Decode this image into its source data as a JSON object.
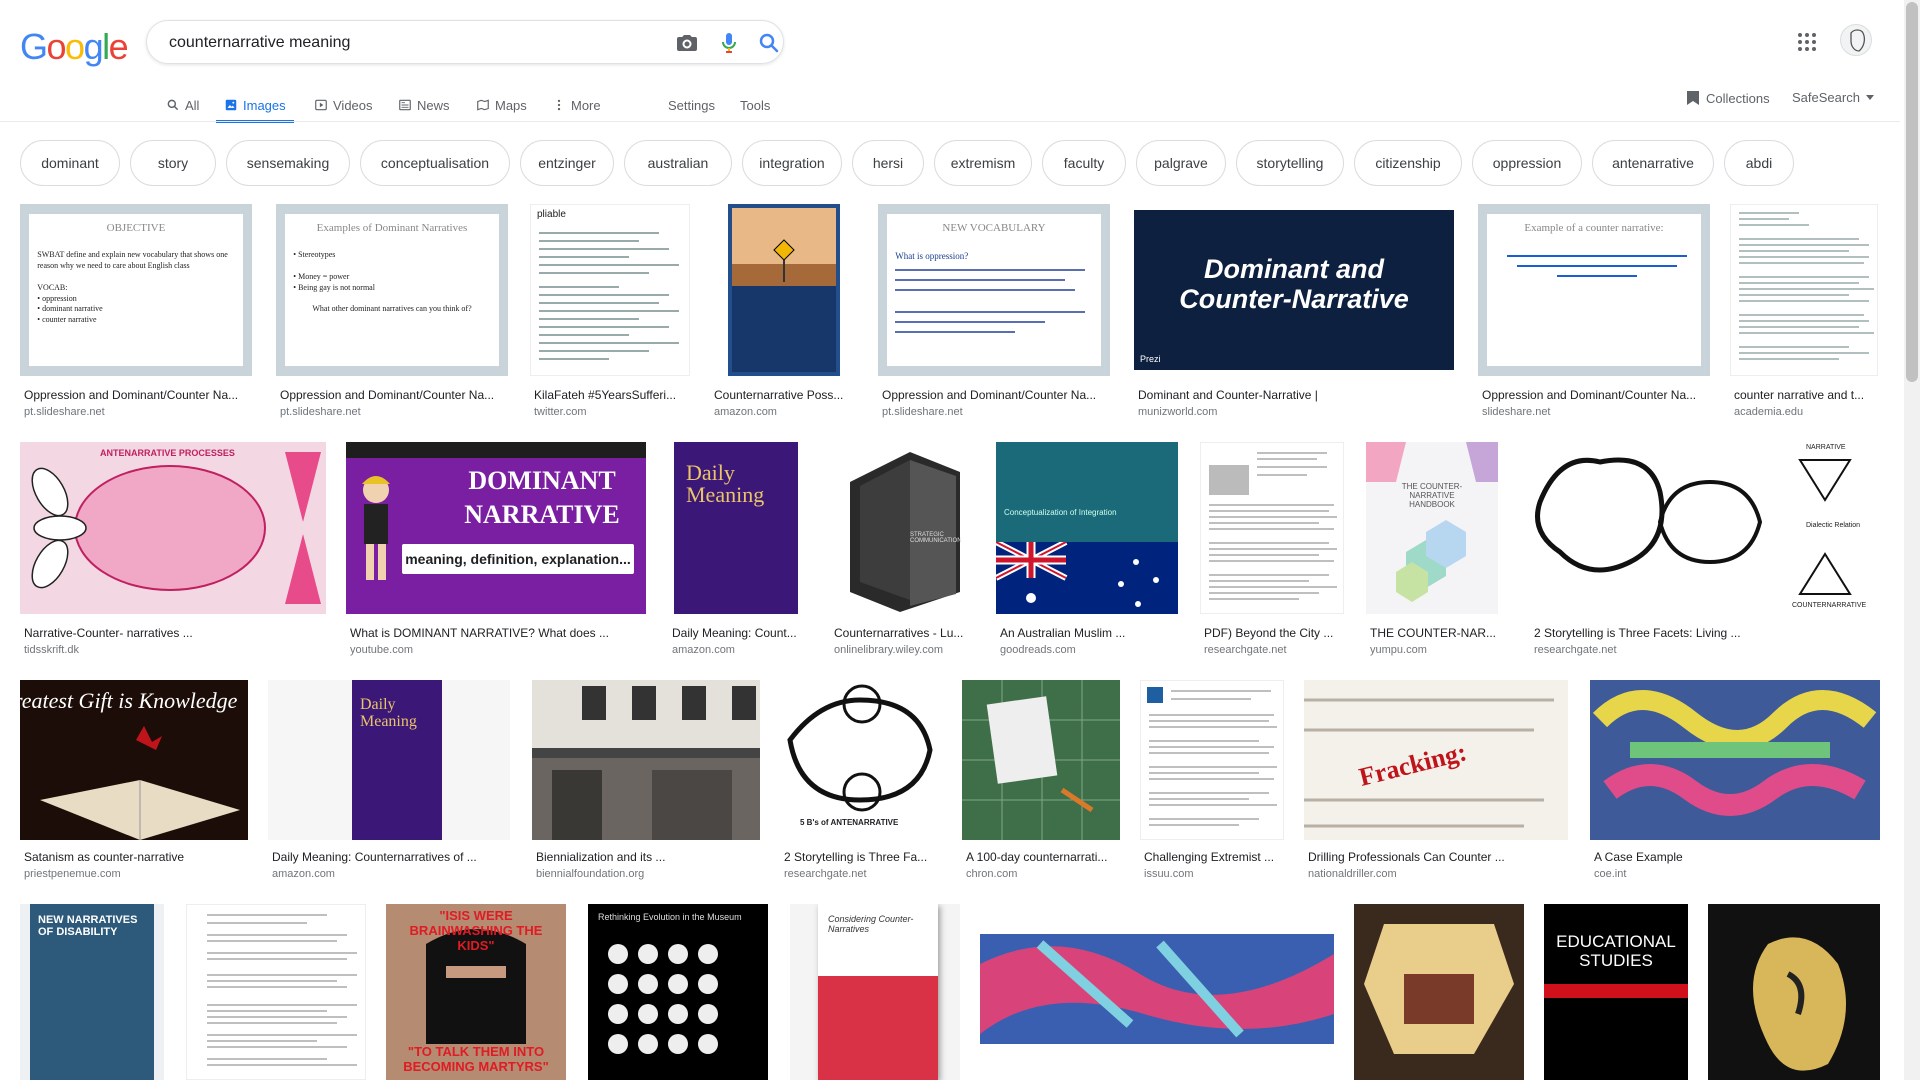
{
  "logo": [
    "G",
    "o",
    "o",
    "g",
    "l",
    "e"
  ],
  "search": {
    "query": "counternarrative meaning"
  },
  "tabs": [
    {
      "label": "All"
    },
    {
      "label": "Images"
    },
    {
      "label": "Videos"
    },
    {
      "label": "News"
    },
    {
      "label": "Maps"
    },
    {
      "label": "More"
    }
  ],
  "tools": {
    "settings": "Settings",
    "tools": "Tools"
  },
  "right": {
    "collections": "Collections",
    "safesearch": "SafeSearch"
  },
  "chips": [
    "dominant",
    "story",
    "sensemaking",
    "conceptualisation",
    "entzinger",
    "australian",
    "integration",
    "hersi",
    "extremism",
    "faculty",
    "palgrave",
    "storytelling",
    "citizenship",
    "oppression",
    "antenarrative",
    "abdi"
  ],
  "thumb_text": {
    "t1_title": "OBJECTIVE",
    "t1_body": "SWBAT define and explain new vocabulary that shows one reason why we need to care about English class",
    "t1_vocab": "VOCAB:",
    "t1_v1": "oppression",
    "t1_v2": "dominant narrative",
    "t1_v3": "counter narrative",
    "t2_title": "Examples of Dominant Narratives",
    "t2_b1": "Stereotypes",
    "t2_b2": "Money = power",
    "t2_b3": "Being gay is not normal",
    "t2_q": "What other dominant narratives can you think of?",
    "t3_word": "pliable",
    "t5_title": "NEW VOCABULARY",
    "t5_body": "What is oppression?",
    "t6_text": "Dominant and Counter-Narrative",
    "t6_brand": "Prezi",
    "t7_title": "Example of a counter narrative:",
    "r2_1": "ANTENARRATIVE PROCESSES",
    "r2_2a": "DOMINANT",
    "r2_2b": "NARRATIVE",
    "r2_2c": "meaning, definition, explanation...",
    "r2_3a": "Daily",
    "r2_3b": "Meaning",
    "r2_4": "STRATEGIC COMMUNICATION",
    "r2_5": "Conceptualization of Integration",
    "r2_7": "THE COUNTER-NARRATIVE HANDBOOK",
    "r2_8a": "NARRATIVE",
    "r2_8b": "COUNTERNARRATIVE",
    "r2_8c": "Dialectic Relation",
    "r3_1": "reatest Gift is Knowledge",
    "r3_4": "5 B's of ANTENARRATIVE",
    "r3_7": "Fracking:",
    "r4_1a": "NEW NARRATIVES",
    "r4_1b": "OF DISABILITY",
    "r4_3a": "\"ISIS WERE BRAINWASHING THE KIDS\"",
    "r4_3b": "\"TO TALK THEM INTO BECOMING MARTYRS\"",
    "r4_4": "Rethinking Evolution in the Museum",
    "r4_5": "Considering Counter-Narratives",
    "r4_8a": "EDUCATIONAL",
    "r4_8b": "STUDIES"
  },
  "row1": [
    {
      "title": "Oppression and Dominant/Counter Na...",
      "source": "pt.slideshare.net"
    },
    {
      "title": "Oppression and Dominant/Counter Na...",
      "source": "pt.slideshare.net"
    },
    {
      "title": "KilaFateh #5YearsSufferi...",
      "source": "twitter.com"
    },
    {
      "title": "Counternarrative Poss...",
      "source": "amazon.com"
    },
    {
      "title": "Oppression and Dominant/Counter Na...",
      "source": "pt.slideshare.net"
    },
    {
      "title": "Dominant and Counter-Narrative |",
      "source": "munizworld.com"
    },
    {
      "title": "Oppression and Dominant/Counter Na...",
      "source": "slideshare.net"
    },
    {
      "title": "counter narrative and t...",
      "source": "academia.edu"
    }
  ],
  "row2": [
    {
      "title": "Narrative-Counter- narratives ...",
      "source": "tidsskrift.dk"
    },
    {
      "title": "What is DOMINANT NARRATIVE? What does ...",
      "source": "youtube.com"
    },
    {
      "title": "Daily Meaning: Count...",
      "source": "amazon.com"
    },
    {
      "title": "Counternarratives - Lu...",
      "source": "onlinelibrary.wiley.com"
    },
    {
      "title": "An Australian Muslim ...",
      "source": "goodreads.com"
    },
    {
      "title": "PDF) Beyond the City ...",
      "source": "researchgate.net"
    },
    {
      "title": "THE COUNTER-NAR...",
      "source": "yumpu.com"
    },
    {
      "title": "2 Storytelling is Three Facets: Living ...",
      "source": "researchgate.net"
    }
  ],
  "row3": [
    {
      "title": "Satanism as counter-narrative",
      "source": "priestpenemue.com"
    },
    {
      "title": "Daily Meaning: Counternarratives of ...",
      "source": "amazon.com"
    },
    {
      "title": "Biennialization and its ...",
      "source": "biennialfoundation.org"
    },
    {
      "title": "2 Storytelling is Three Fa...",
      "source": "researchgate.net"
    },
    {
      "title": "A 100-day counternarrati...",
      "source": "chron.com"
    },
    {
      "title": "Challenging Extremist ...",
      "source": "issuu.com"
    },
    {
      "title": "Drilling Professionals Can Counter ...",
      "source": "nationaldriller.com"
    },
    {
      "title": "A Case Example",
      "source": "coe.int"
    }
  ],
  "colors": {
    "accent": "#1a73e8",
    "chip_border": "#dadce0"
  }
}
